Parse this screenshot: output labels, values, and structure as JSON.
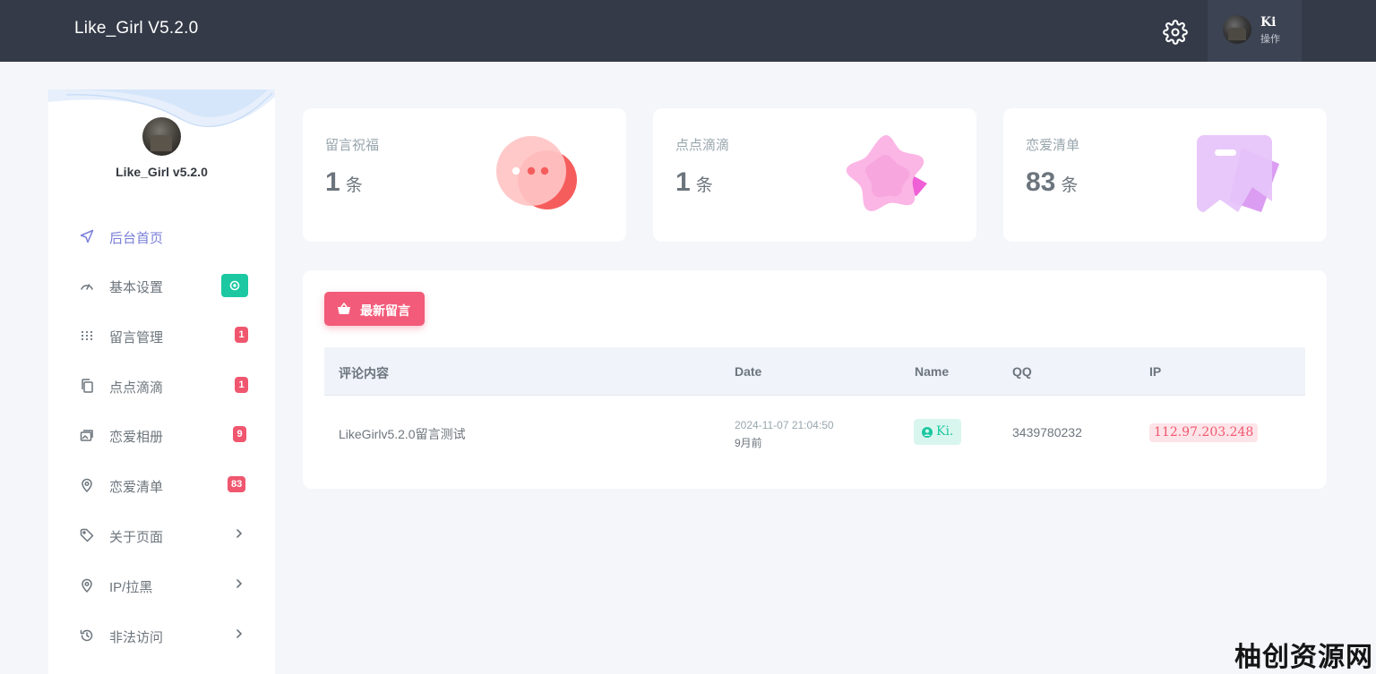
{
  "header": {
    "brand": "Like_Girl V5.2.0",
    "user_name": "Ki",
    "user_role": "操作"
  },
  "sidebar": {
    "site_name": "Like_Girl v5.2.0",
    "items": [
      {
        "label": "后台首页",
        "icon": "send-icon",
        "active": true
      },
      {
        "label": "基本设置",
        "icon": "gauge-icon",
        "badge_icon": "settings-badge-icon"
      },
      {
        "label": "留言管理",
        "icon": "grid-dots-icon",
        "badge": "1"
      },
      {
        "label": "点点滴滴",
        "icon": "copy-icon",
        "badge": "1"
      },
      {
        "label": "恋爱相册",
        "icon": "photo-stack-icon",
        "badge": "9"
      },
      {
        "label": "恋爱清单",
        "icon": "map-pin-icon",
        "badge": "83"
      },
      {
        "label": "关于页面",
        "icon": "tag-icon",
        "chevron": true
      },
      {
        "label": "IP/拉黑",
        "icon": "map-pin-icon",
        "chevron": true
      },
      {
        "label": "非法访问",
        "icon": "history-icon",
        "chevron": true
      }
    ]
  },
  "stats": [
    {
      "label": "留言祝福",
      "value": "1",
      "unit": "条",
      "icon": "chat-bubbles-icon"
    },
    {
      "label": "点点滴滴",
      "value": "1",
      "unit": "条",
      "icon": "star-icon"
    },
    {
      "label": "恋爱清单",
      "value": "83",
      "unit": "条",
      "icon": "bag-icon"
    }
  ],
  "panel": {
    "button_label": "最新留言",
    "columns": [
      "评论内容",
      "Date",
      "Name",
      "QQ",
      "IP"
    ],
    "rows": [
      {
        "content": "LikeGirlv5.2.0留言测试",
        "date": "2024-11-07 21:04:50",
        "relative": "9月前",
        "name": "Ki.",
        "qq": "3439780232",
        "ip": "112.97.203.248"
      }
    ]
  },
  "watermark": "柚创资源网",
  "colors": {
    "topbar": "#343a48",
    "accent_pink": "#f25b79",
    "accent_green": "#1bc8a1",
    "active_nav": "#7a7fd8"
  }
}
